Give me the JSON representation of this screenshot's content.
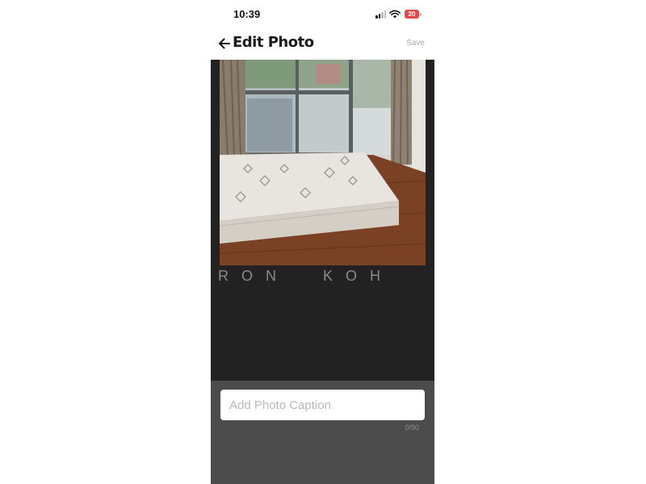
{
  "status_bar": {
    "time": "10:39",
    "battery_level": "20",
    "battery_color": "#e24a4a",
    "signal_icon": "cellular-signal-icon",
    "wifi_icon": "wifi-icon"
  },
  "header": {
    "back_icon": "arrow-left-icon",
    "title": "Edit Photo",
    "save_label": "Save"
  },
  "photo": {
    "description_icon": "bedroom-mattress-photo",
    "watermark": "RON  KOH"
  },
  "caption": {
    "placeholder": "Add Photo Caption",
    "value": "",
    "char_count": "0/90"
  },
  "colors": {
    "photo_background": "#222222",
    "caption_background": "#4c4c4c",
    "save_disabled": "#a9a9a9"
  }
}
